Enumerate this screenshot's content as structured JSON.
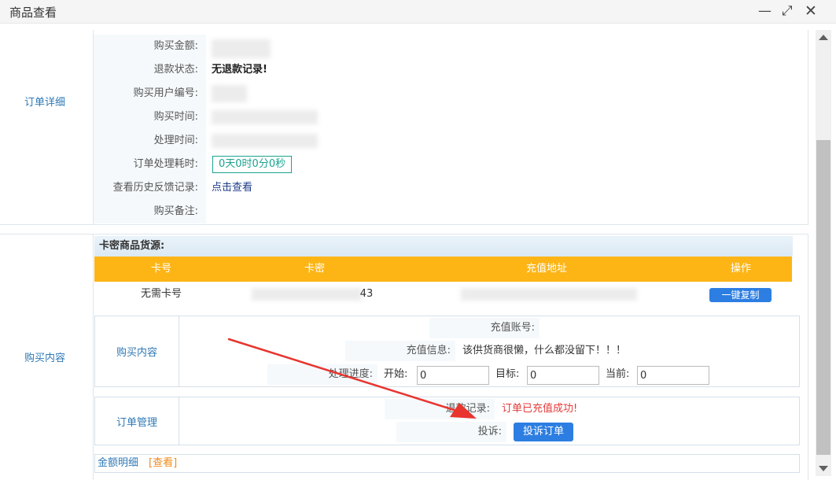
{
  "window": {
    "title": "商品查看"
  },
  "order_detail": {
    "section_label": "订单详细",
    "purchase_amount_label": "购买金额:",
    "refund_status_label": "退款状态:",
    "refund_status_value": "无退款记录!",
    "buyer_id_label": "购买用户编号:",
    "purchase_time_label": "购买时间:",
    "process_time_label": "处理时间:",
    "process_duration_label": "订单处理耗时:",
    "process_duration_value": "0天0时0分0秒",
    "history_label": "查看历史反馈记录:",
    "history_link": "点击查看",
    "remark_label": "购买备注:"
  },
  "purchase_content": {
    "section_label": "购买内容",
    "card_source_title": "卡密商品货源:",
    "table": {
      "headers": [
        "卡号",
        "卡密",
        "充值地址",
        "操作"
      ],
      "row": {
        "card_no": "无需卡号",
        "card_pwd_tail": "43",
        "action_button": "一键复制"
      }
    },
    "content_box": {
      "label": "购买内容",
      "account_label": "充值账号:",
      "info_label": "充值信息:",
      "info_value": "该供货商很懒，什么都没留下！！！",
      "progress_label": "处理进度:",
      "start_label": "开始:",
      "start_value": "0",
      "target_label": "目标:",
      "target_value": "0",
      "current_label": "当前:",
      "current_value": "0"
    },
    "order_manage": {
      "label": "订单管理",
      "refund_record_label": "退款记录:",
      "refund_record_value": "订单已充值成功!",
      "complain_label": "投诉:",
      "complain_button": "投诉订单"
    },
    "amount_detail": {
      "label": "金额明细",
      "link": "[查看]"
    }
  },
  "colors": {
    "accent_blue": "#2d7ee2",
    "header_orange": "#fdb516",
    "teal": "#1aa38e",
    "red": "#e43a3a",
    "arrow_red": "#e8352f"
  }
}
